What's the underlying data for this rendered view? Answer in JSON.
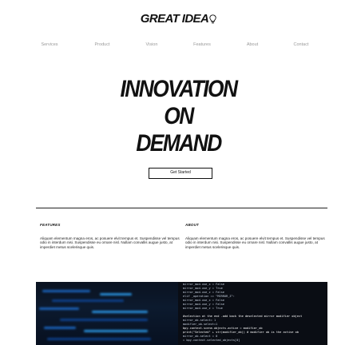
{
  "logo": {
    "text": "GREAT IDEA"
  },
  "nav": {
    "items": [
      {
        "label": "Services"
      },
      {
        "label": "Product"
      },
      {
        "label": "Vision"
      },
      {
        "label": "Features"
      },
      {
        "label": "About"
      },
      {
        "label": "Contact"
      }
    ]
  },
  "hero": {
    "line1": "INNOVATION",
    "line2": "ON",
    "line3": "DEMAND",
    "cta_label": "Get Started"
  },
  "features": {
    "title": "FEATURES",
    "body": "Aliquam elementum magna eros, ac posuere elvit tempus et. Suspendisse vel tempus odio in interdum nisi. Suspendisse eu ornare nisl. Nullam convallis augue justo, at imperdiet metus scelerisque quis."
  },
  "about": {
    "title": "ABOUT",
    "body": "Aliquam elementum magna eros, ac posuere elvit tempus et. Suspendisse vel tempus odio in interdum nisi. Suspendisse eu ornare nisl. Nullam convallis augue justo, at imperdiet metus scelerisque quis."
  },
  "code_image": {
    "lines": [
      "mirror_mod.use_x = False",
      "mirror_mod.use_y = True",
      "mirror_mod.use_z = False",
      "elif _operation == \"MIRROR_Z\":",
      "mirror_mod.use_x = False",
      "mirror_mod.use_y = False",
      "mirror_mod.use_z = True",
      "",
      "#selection at the end -add back the deselected mirror modifier object",
      "mirror_ob.select= 1",
      "modifier_ob.select=1",
      "bpy.context.scene.objects.active = modifier_ob",
      "print(\"Selected\" + str(modifier_ob)) # modifier ob is the active ob",
      "mirror_ob.select = 0",
      "= bpy.context.selected_objects[0]"
    ]
  },
  "colors": {
    "text": "#111111",
    "nav": "#9a9a9a",
    "code_bg": "#0a0d14",
    "glow": "#1e73d8"
  }
}
